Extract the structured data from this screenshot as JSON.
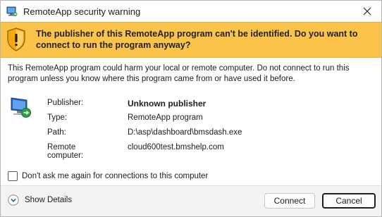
{
  "window": {
    "title": "RemoteApp security warning",
    "close_label": "✕"
  },
  "banner": {
    "message": "The publisher of this RemoteApp program can't be identified. Do you want to connect to run the program anyway?",
    "color": "#fbc34a"
  },
  "description": "This RemoteApp program could harm your local or remote computer. Do not connect to run this program unless you know where this program came from or have used it before.",
  "details": {
    "publisher_label": "Publisher:",
    "publisher_value": "Unknown publisher",
    "type_label": "Type:",
    "type_value": "RemoteApp program",
    "path_label": "Path:",
    "path_value": "D:\\asp\\dashboard\\bmsdash.exe",
    "remote_label": "Remote computer:",
    "remote_value": "cloud600test.bmshelp.com"
  },
  "checkbox": {
    "label": "Don't ask me again for connections to this computer",
    "checked": false
  },
  "footer": {
    "show_details_label": "Show Details",
    "connect_label": "Connect",
    "cancel_label": "Cancel"
  },
  "icons": {
    "app": "remoteapp-icon",
    "warning": "shield-warning-icon",
    "computer": "remote-computer-icon",
    "expand": "chevron-down-circle-icon",
    "close": "close-icon"
  }
}
